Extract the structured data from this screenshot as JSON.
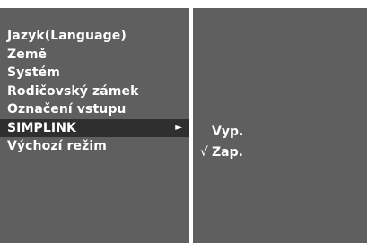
{
  "menu": {
    "items": [
      {
        "label": "Jazyk(Language)"
      },
      {
        "label": "Země"
      },
      {
        "label": "Systém"
      },
      {
        "label": "Rodičovský zámek"
      },
      {
        "label": "Označení vstupu"
      },
      {
        "label": "SIMPLINK",
        "selected": true
      },
      {
        "label": "Výchozí režim"
      }
    ],
    "submenu_arrow": "►"
  },
  "submenu": {
    "options": [
      {
        "label": "Vyp.",
        "mark": ""
      },
      {
        "label": "Zap.",
        "mark": "√"
      }
    ]
  },
  "colors": {
    "panel": "#5f5f5f",
    "selected_row": "#2f2f2f",
    "text": "#ffffff",
    "background": "#ffffff"
  }
}
